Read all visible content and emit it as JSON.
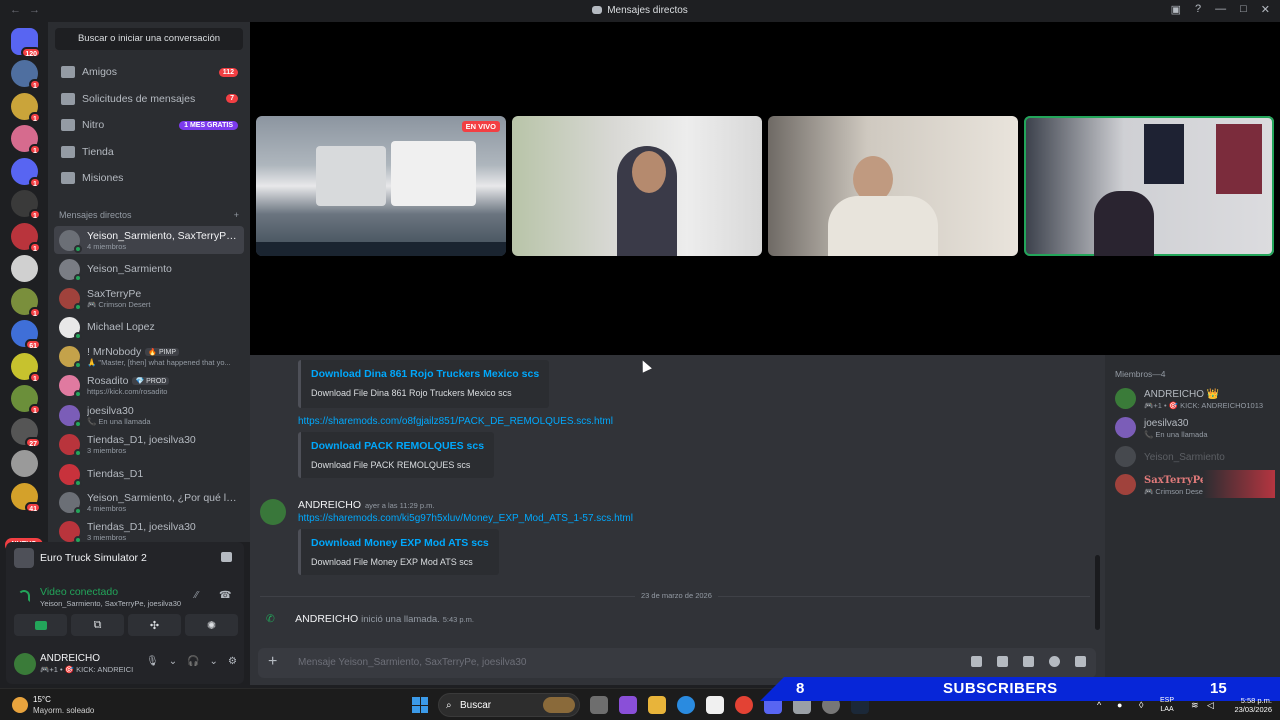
{
  "window": {
    "title": "Mensajes directos"
  },
  "guilds": {
    "home_badge": "120",
    "items": [
      {
        "color": "#4f6fa0",
        "badge": "1"
      },
      {
        "color": "#caa43a",
        "badge": "1"
      },
      {
        "color": "#d66b8e",
        "badge": "1"
      },
      {
        "color": "#5865f2",
        "badge": "1"
      },
      {
        "color": "#3a3a3a",
        "badge": "1"
      },
      {
        "color": "#b9343c",
        "badge": "1"
      },
      {
        "color": "#d0d0d0",
        "badge": ""
      },
      {
        "color": "#7a8f3c",
        "badge": "1"
      },
      {
        "color": "#3f6fd8",
        "badge": "61"
      },
      {
        "color": "#c7c22e",
        "badge": "1"
      },
      {
        "color": "#6b8f3a",
        "badge": "1"
      },
      {
        "color": "#555555",
        "badge": "27"
      },
      {
        "color": "#9a9a9a",
        "badge": ""
      },
      {
        "color": "#d4a12a",
        "badge": "41"
      }
    ],
    "new_label": "NUEVO"
  },
  "sidebar": {
    "search_label": "Buscar o iniciar una conversación",
    "nav": [
      {
        "label": "Amigos",
        "badge": "112"
      },
      {
        "label": "Solicitudes de mensajes",
        "badge": "7"
      },
      {
        "label": "Nitro",
        "promo": "1 MES GRATIS"
      },
      {
        "label": "Tienda"
      },
      {
        "label": "Misiones"
      }
    ],
    "dm_header": "Mensajes directos",
    "dm_add": "+",
    "dms": [
      {
        "name": "Yeison_Sarmiento, SaxTerryPe, ...",
        "sub": "4 miembros",
        "active": true,
        "color": "#6b6f76"
      },
      {
        "name": "Yeison_Sarmiento",
        "sub": "",
        "color": "#7a7d84"
      },
      {
        "name": "SaxTerryPe",
        "sub": "🎮 Crimson Desert",
        "color": "#a0423c"
      },
      {
        "name": "Michael Lopez",
        "sub": "",
        "color": "#e8e8e8"
      },
      {
        "name": "! MrNobody",
        "tag": "🔥 PIMP",
        "sub": "🙏 \"Master, [then] what happened that yo...",
        "color": "#c4a24a"
      },
      {
        "name": "Rosadito",
        "tag": "💎 PROD",
        "sub": "https://kick.com/rosadito",
        "color": "#e07aa0"
      },
      {
        "name": "joesilva30",
        "sub": "📞 En una llamada",
        "color": "#7b5db8"
      },
      {
        "name": "Tiendas_D1, joesilva30",
        "sub": "3 miembros",
        "color": "#b9343c"
      },
      {
        "name": "Tiendas_D1",
        "sub": "",
        "color": "#c8323c"
      },
      {
        "name": "Yeison_Sarmiento, ¿Por qué la ...",
        "sub": "4 miembros",
        "color": "#6b6f76"
      },
      {
        "name": "Tiendas_D1, joesilva30",
        "sub": "3 miembros",
        "color": "#b9343c"
      }
    ]
  },
  "activity": {
    "game": "Euro Truck Simulator 2"
  },
  "voice": {
    "status": "Video conectado",
    "participants": "Yeison_Sarmiento, SaxTerryPe, joesilva30"
  },
  "user": {
    "name": "ANDREICHO",
    "status": "🎮+1 • 🎯 KICK: ANDREICI"
  },
  "stage": {
    "live_label": "EN VIVO"
  },
  "chat": {
    "embed1": {
      "title": "Download Dina 861 Rojo Truckers Mexico scs",
      "desc": "Download File Dina 861 Rojo Truckers Mexico scs"
    },
    "link2": "https://sharemods.com/o8fgjailz851/PACK_DE_REMOLQUES.scs.html",
    "embed2": {
      "title": "Download PACK REMOLQUES scs",
      "desc": "Download File PACK REMOLQUES scs"
    },
    "msg3": {
      "author": "ANDREICHO",
      "time": "ayer a las 11:29 p.m.",
      "link": "https://sharemods.com/ki5g97h5xluv/Money_EXP_Mod_ATS_1-57.scs.html"
    },
    "embed3": {
      "title": "Download Money EXP Mod ATS scs",
      "desc": "Download File Money EXP Mod ATS scs"
    },
    "date_divider": "23 de marzo de 2026",
    "call": {
      "author": "ANDREICHO",
      "action": "inició una llamada.",
      "time": "5:43 p.m."
    },
    "composer_placeholder": "Mensaje Yeison_Sarmiento, SaxTerryPe, joesilva30"
  },
  "members": {
    "header": "Miembros—4",
    "list": [
      {
        "name": "ANDREICHO 👑",
        "sub": "🎮+1 • 🎯 KICK: ANDREICHO1013",
        "color": "#3a7b39"
      },
      {
        "name": "joesilva30",
        "sub": "📞 En una llamada",
        "color": "#7b5db8"
      },
      {
        "name": "Yeison_Sarmiento",
        "sub": "",
        "color": "#7a7d84",
        "dim": true
      },
      {
        "name": "SaxTerryPe",
        "sub": "🎮 Crimson Desert",
        "color": "#a0423c"
      }
    ]
  },
  "taskbar": {
    "temp": "15°C",
    "weather": "Mayorm. soleado",
    "search": "Buscar",
    "lang1": "ESP",
    "lang2": "LAA",
    "time": "5:58 p.m.",
    "date": "23/03/2026"
  },
  "overlay": {
    "count": "8",
    "label": "SUBSCRIBERS",
    "goal": "15"
  }
}
